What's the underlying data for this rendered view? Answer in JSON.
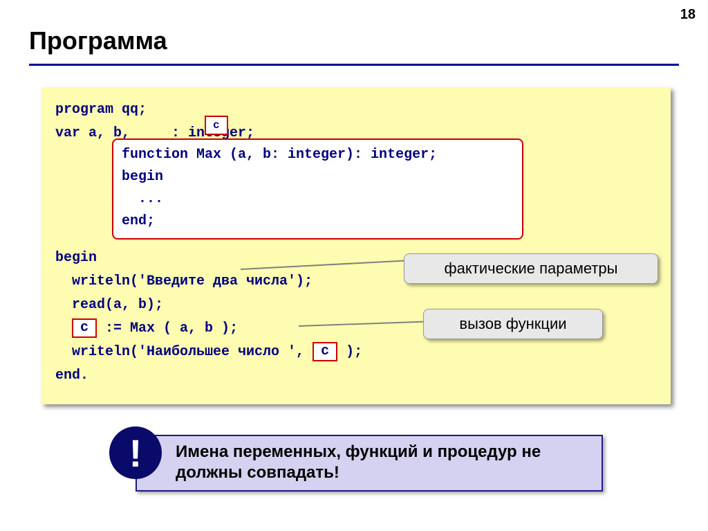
{
  "page_number": "18",
  "title": "Программа",
  "code": {
    "line1": "program qq;",
    "line2_a": "var a, b, ",
    "line2_b": ": integer;",
    "line_begin": "begin",
    "line_writeln1": "  writeln('Введите два числа');",
    "line_read": "  read(a, b);",
    "line_assign_a": "  ",
    "line_assign_b": " := Max ( a, b );",
    "line_writeln2_a": "  writeln('Наибольшее число ', ",
    "line_writeln2_b": " );",
    "line_end": "end."
  },
  "var_c": "c",
  "fn": {
    "line1": "function Max (a, b: integer): integer;",
    "line2": "begin",
    "line3": "  ...",
    "line4": "end;"
  },
  "callouts": {
    "params": "фактические параметры",
    "call": "вызов функции"
  },
  "note": {
    "icon": "!",
    "text": "Имена переменных, функций и процедур не должны совпадать!"
  }
}
